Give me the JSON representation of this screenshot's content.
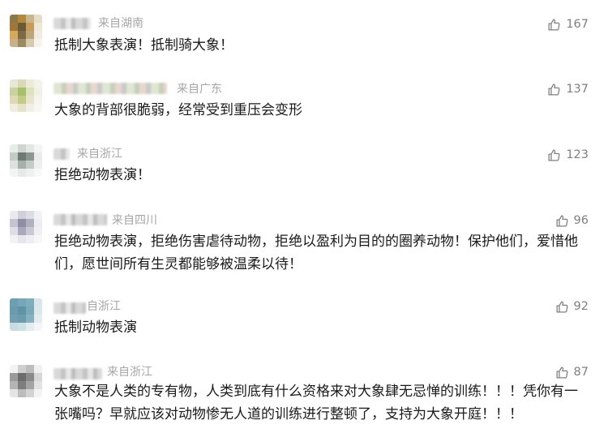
{
  "comments": [
    {
      "location": "来自湖南",
      "likes": "167",
      "text": "抵制大象表演！抵制骑大象！"
    },
    {
      "location": "来自广东",
      "likes": "137",
      "text": "大象的背部很脆弱，经常受到重压会变形"
    },
    {
      "location": "来自浙江",
      "likes": "123",
      "text": "拒绝动物表演！"
    },
    {
      "location": "来自四川",
      "likes": "96",
      "text": "拒绝动物表演，拒绝伤害虐待动物，拒绝以盈利为目的的圈养动物！保护他们，爱惜他们，愿世间所有生灵都能够被温柔以待！"
    },
    {
      "location": "自浙江",
      "likes": "92",
      "text": "抵制动物表演"
    },
    {
      "location": "来自浙江",
      "likes": "87",
      "text": "大象不是人类的专有物，人类到底有什么资格来对大象肆无忌惮的训练！！！凭你有一张嘴吗？早就应该对动物惨无人道的训练进行整顿了，支持为大象开庭！！！"
    }
  ],
  "icons": {
    "like": "thumbs-up-icon",
    "avatar": "pixelated-avatar"
  },
  "colors": {
    "text": "#1a1a1a",
    "meta": "#a6a6a6",
    "like": "#7f7f7f"
  }
}
